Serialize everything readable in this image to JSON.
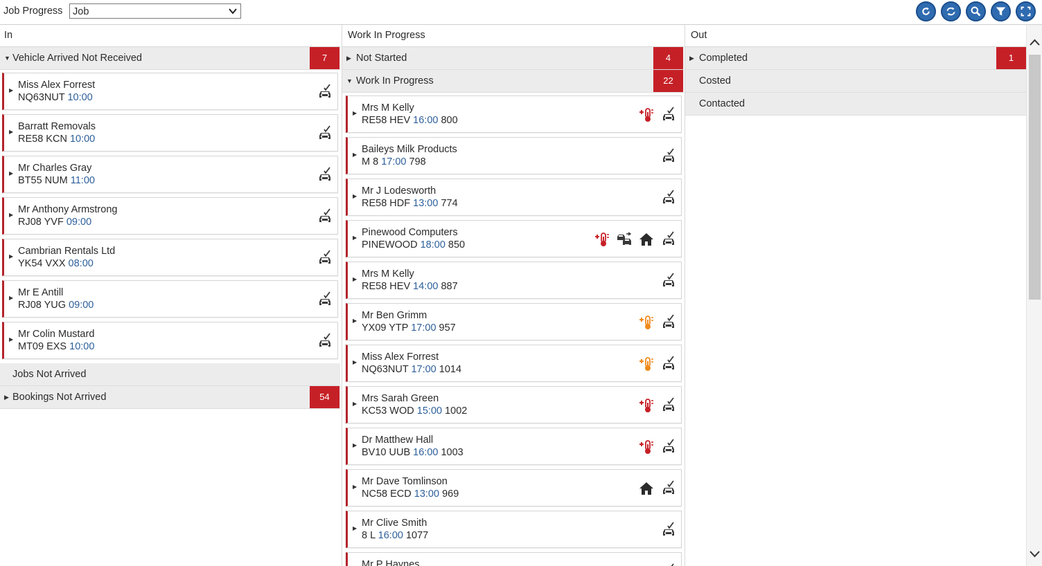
{
  "header": {
    "title": "Job Progress",
    "view_select": "Job"
  },
  "tools": [
    {
      "name": "refresh-icon"
    },
    {
      "name": "sync-icon"
    },
    {
      "name": "search-icon"
    },
    {
      "name": "filter-icon"
    },
    {
      "name": "fullscreen-icon"
    }
  ],
  "columns": {
    "in": {
      "title": "In",
      "group1": {
        "label": "Vehicle Arrived Not Received",
        "count": "7"
      },
      "cards": [
        {
          "name": "Miss Alex Forrest",
          "reg": "NQ63NUT",
          "time": "10:00",
          "extra": ""
        },
        {
          "name": "Barratt Removals",
          "reg": "RE58 KCN",
          "time": "10:00",
          "extra": ""
        },
        {
          "name": "Mr Charles Gray",
          "reg": "BT55 NUM",
          "time": "11:00",
          "extra": ""
        },
        {
          "name": "Mr Anthony Armstrong",
          "reg": "RJ08 YVF",
          "time": "09:00",
          "extra": ""
        },
        {
          "name": "Cambrian Rentals Ltd",
          "reg": "YK54 VXX",
          "time": "08:00",
          "extra": ""
        },
        {
          "name": "Mr E Antill",
          "reg": "RJ08 YUG",
          "time": "09:00",
          "extra": ""
        },
        {
          "name": "Mr Colin Mustard",
          "reg": "MT09 EXS",
          "time": "10:00",
          "extra": ""
        }
      ],
      "group2": {
        "label": "Jobs Not Arrived"
      },
      "group3": {
        "label": "Bookings Not Arrived",
        "count": "54"
      }
    },
    "wip": {
      "title": "Work In Progress",
      "group1": {
        "label": "Not Started",
        "count": "4"
      },
      "group2": {
        "label": "Work In Progress",
        "count": "22"
      },
      "cards": [
        {
          "name": "Mrs M Kelly",
          "reg": "RE58 HEV",
          "time": "16:00",
          "extra": "800",
          "icons": [
            "temp-red",
            "car"
          ]
        },
        {
          "name": "Baileys Milk Products",
          "reg": "M 8",
          "time": "17:00",
          "extra": "798",
          "icons": [
            "car"
          ]
        },
        {
          "name": "Mr J Lodesworth",
          "reg": "RE58 HDF",
          "time": "13:00",
          "extra": "774",
          "icons": [
            "car"
          ]
        },
        {
          "name": "Pinewood Computers",
          "reg": "PINEWOOD",
          "time": "18:00",
          "extra": "850",
          "icons": [
            "temp-red",
            "courtesy",
            "home",
            "car"
          ]
        },
        {
          "name": "Mrs M Kelly",
          "reg": "RE58 HEV",
          "time": "14:00",
          "extra": "887",
          "icons": [
            "car"
          ]
        },
        {
          "name": "Mr Ben Grimm",
          "reg": "YX09 YTP",
          "time": "17:00",
          "extra": "957",
          "icons": [
            "temp-orange",
            "car"
          ]
        },
        {
          "name": "Miss Alex Forrest",
          "reg": "NQ63NUT",
          "time": "17:00",
          "extra": "1014",
          "icons": [
            "temp-orange",
            "car"
          ]
        },
        {
          "name": "Mrs Sarah Green",
          "reg": "KC53 WOD",
          "time": "15:00",
          "extra": "1002",
          "icons": [
            "temp-red",
            "car"
          ]
        },
        {
          "name": "Dr Matthew Hall",
          "reg": "BV10 UUB",
          "time": "16:00",
          "extra": "1003",
          "icons": [
            "temp-red",
            "car"
          ]
        },
        {
          "name": "Mr Dave Tomlinson",
          "reg": "NC58 ECD",
          "time": "13:00",
          "extra": "969",
          "icons": [
            "home",
            "car"
          ]
        },
        {
          "name": "Mr Clive Smith",
          "reg": "8 L",
          "time": "16:00",
          "extra": "1077",
          "icons": [
            "car"
          ]
        },
        {
          "name": "Mr P Haynes",
          "reg": "",
          "time": "",
          "extra": "",
          "icons": [
            "car"
          ]
        }
      ]
    },
    "out": {
      "title": "Out",
      "groups": [
        {
          "label": "Completed",
          "count": "1"
        },
        {
          "label": "Costed"
        },
        {
          "label": "Contacted"
        }
      ]
    }
  },
  "colors": {
    "accent": "#c62027",
    "tool_blue": "#2f6bb0",
    "time_blue": "#2d5f9a",
    "warn_orange": "#f08a1c"
  }
}
